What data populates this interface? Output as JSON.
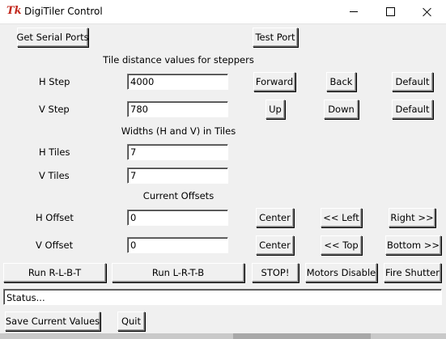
{
  "window": {
    "icon_text": "Tk",
    "title": "DigiTiler Control",
    "controls": {
      "minimize": "minimize-icon",
      "maximize": "maximize-icon",
      "close": "close-icon"
    }
  },
  "buttons": {
    "get_serial_ports": "Get Serial Ports",
    "test_port": "Test Port",
    "forward": "Forward",
    "back": "Back",
    "default_h": "Default",
    "up": "Up",
    "down": "Down",
    "default_v": "Default",
    "center_h": "Center",
    "left": "<< Left",
    "right": "Right >>",
    "center_v": "Center",
    "top": "<< Top",
    "bottom": "Bottom >>",
    "run_rlbt": "Run R-L-B-T",
    "run_lrtb": "Run L-R-T-B",
    "stop": "STOP!",
    "motors_disable": "Motors Disable",
    "fire_shutter": "Fire Shutter",
    "save_values": "Save Current Values",
    "quit": "Quit"
  },
  "sections": {
    "tile_distance": "Tile distance values for steppers",
    "widths": "Widths (H and V) in Tiles",
    "offsets": "Current Offsets"
  },
  "fields": {
    "h_step": {
      "label": "H Step",
      "value": "4000"
    },
    "v_step": {
      "label": "V Step",
      "value": "780"
    },
    "h_tiles": {
      "label": "H Tiles",
      "value": "7"
    },
    "v_tiles": {
      "label": "V Tiles",
      "value": "7"
    },
    "h_offset": {
      "label": "H Offset",
      "value": "0"
    },
    "v_offset": {
      "label": "V Offset",
      "value": "0"
    }
  },
  "status": "Status..."
}
